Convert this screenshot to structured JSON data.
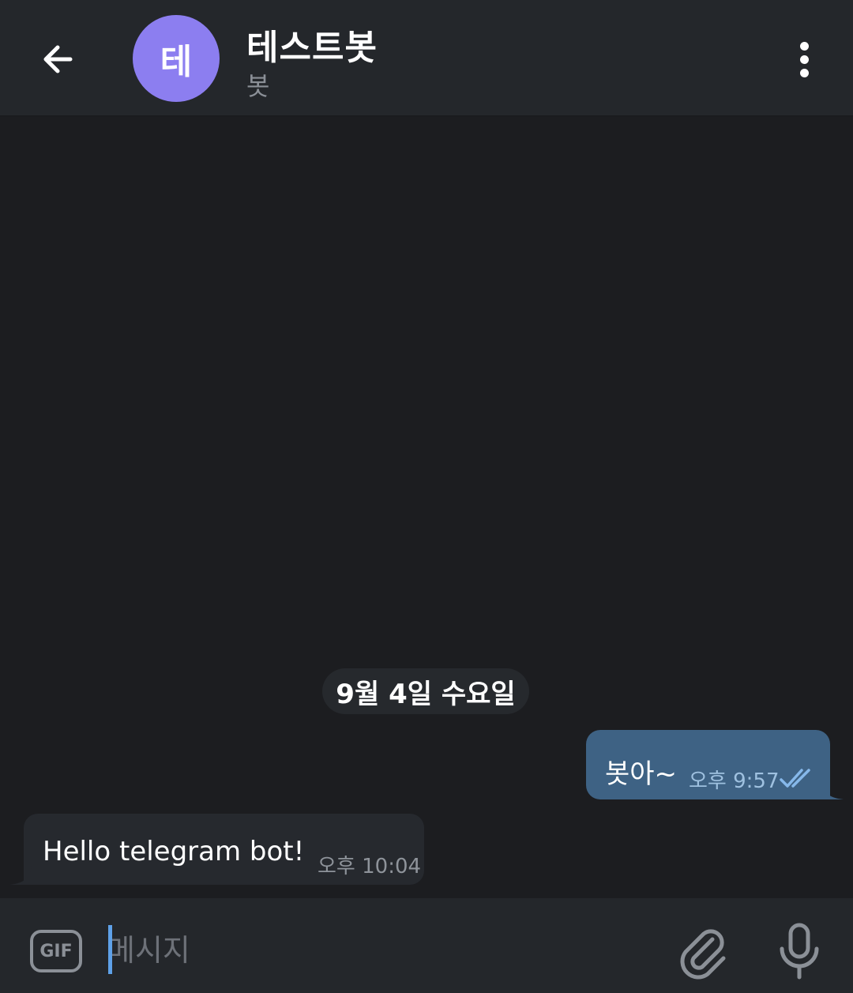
{
  "header": {
    "avatar_letter": "테",
    "title": "테스트봇",
    "subtitle": "봇"
  },
  "chat": {
    "date_separator": "9월 4일 수요일",
    "messages": [
      {
        "direction": "outgoing",
        "text": "봇아~",
        "time": "오후 9:57",
        "status": "read"
      },
      {
        "direction": "incoming",
        "text": "Hello telegram bot!",
        "time": "오후 10:04"
      }
    ]
  },
  "composer": {
    "gif_label": "GIF",
    "placeholder": "메시지"
  },
  "icons": {
    "back": "arrow-left-icon",
    "menu": "more-vertical-icon",
    "read_status": "double-check-icon",
    "attach": "paperclip-icon",
    "mic": "microphone-icon"
  },
  "colors": {
    "background": "#1c1d20",
    "header": "#24272b",
    "avatar": "#8c7ef0",
    "outgoing_bubble": "#3e6284",
    "incoming_bubble": "#26292e",
    "accent": "#5ea1e8"
  }
}
